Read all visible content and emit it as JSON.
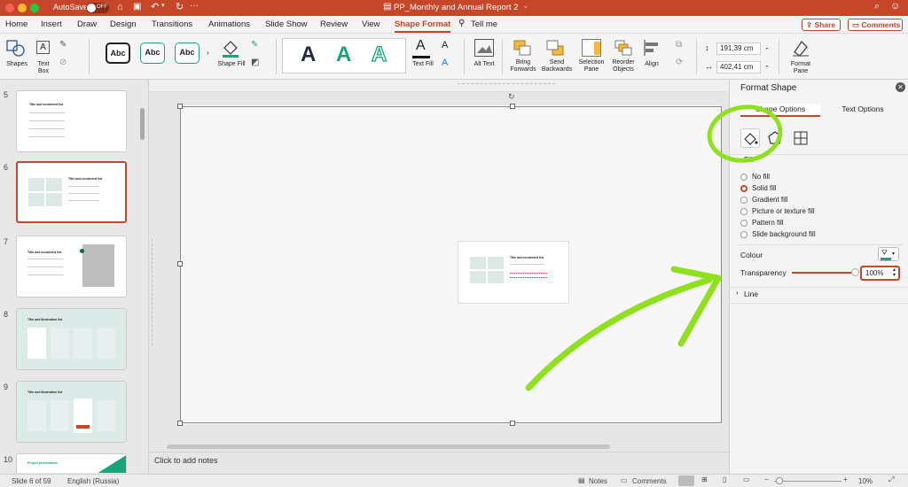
{
  "titlebar": {
    "autosave_label": "AutoSave",
    "autosave_state": "OFF",
    "document_title": "PP_Monthly and Annual Report 2",
    "accent": "#c6462a"
  },
  "tabs": [
    {
      "label": "Home"
    },
    {
      "label": "Insert"
    },
    {
      "label": "Draw"
    },
    {
      "label": "Design"
    },
    {
      "label": "Transitions"
    },
    {
      "label": "Animations"
    },
    {
      "label": "Slide Show"
    },
    {
      "label": "Review"
    },
    {
      "label": "View"
    },
    {
      "label": "Shape Format"
    },
    {
      "label": "Tell me"
    }
  ],
  "share": {
    "share_label": "Share",
    "comments_label": "Comments"
  },
  "ribbon": {
    "shapes": "Shapes",
    "text_box": "Text Box",
    "style_sample": "Abc",
    "shape_fill": "Shape Fill",
    "wordart_sample": "A",
    "text_fill": "Text Fill",
    "alt_text": "Alt Text",
    "bring_forwards": "Bring Forwards",
    "send_backwards": "Send Backwards",
    "selection_pane": "Selection Pane",
    "reorder_objects": "Reorder Objects",
    "align": "Align",
    "height_value": "191,39 cm",
    "width_value": "402,41 cm",
    "format_pane": "Format Pane"
  },
  "thumbs": {
    "n5": "5",
    "n6": "6",
    "n7": "7",
    "n8": "8",
    "n9": "9",
    "n10": "10",
    "title_numbered": "Title and numbered list",
    "title_illustration": "Title and illustration list",
    "project_presentation": "Project presentation"
  },
  "editor": {
    "notes_placeholder": "Click to add notes"
  },
  "format_shape": {
    "title": "Format Shape",
    "tab_shape": "Shape Options",
    "tab_text": "Text Options",
    "fill_header": "Fill",
    "options": [
      "No fill",
      "Solid fill",
      "Gradient fill",
      "Picture or texture fill",
      "Pattern fill",
      "Slide background fill"
    ],
    "selected_index": 1,
    "colour_label": "Colour",
    "transparency_label": "Transparency",
    "transparency_value": "100%",
    "transparency_fraction": 1.0,
    "line_header": "Line"
  },
  "status": {
    "slide_of": "Slide 6 of 59",
    "language": "English (Russia)",
    "notes": "Notes",
    "comments": "Comments",
    "zoom": "10%"
  },
  "annotation": {
    "color": "#8fe01e"
  }
}
